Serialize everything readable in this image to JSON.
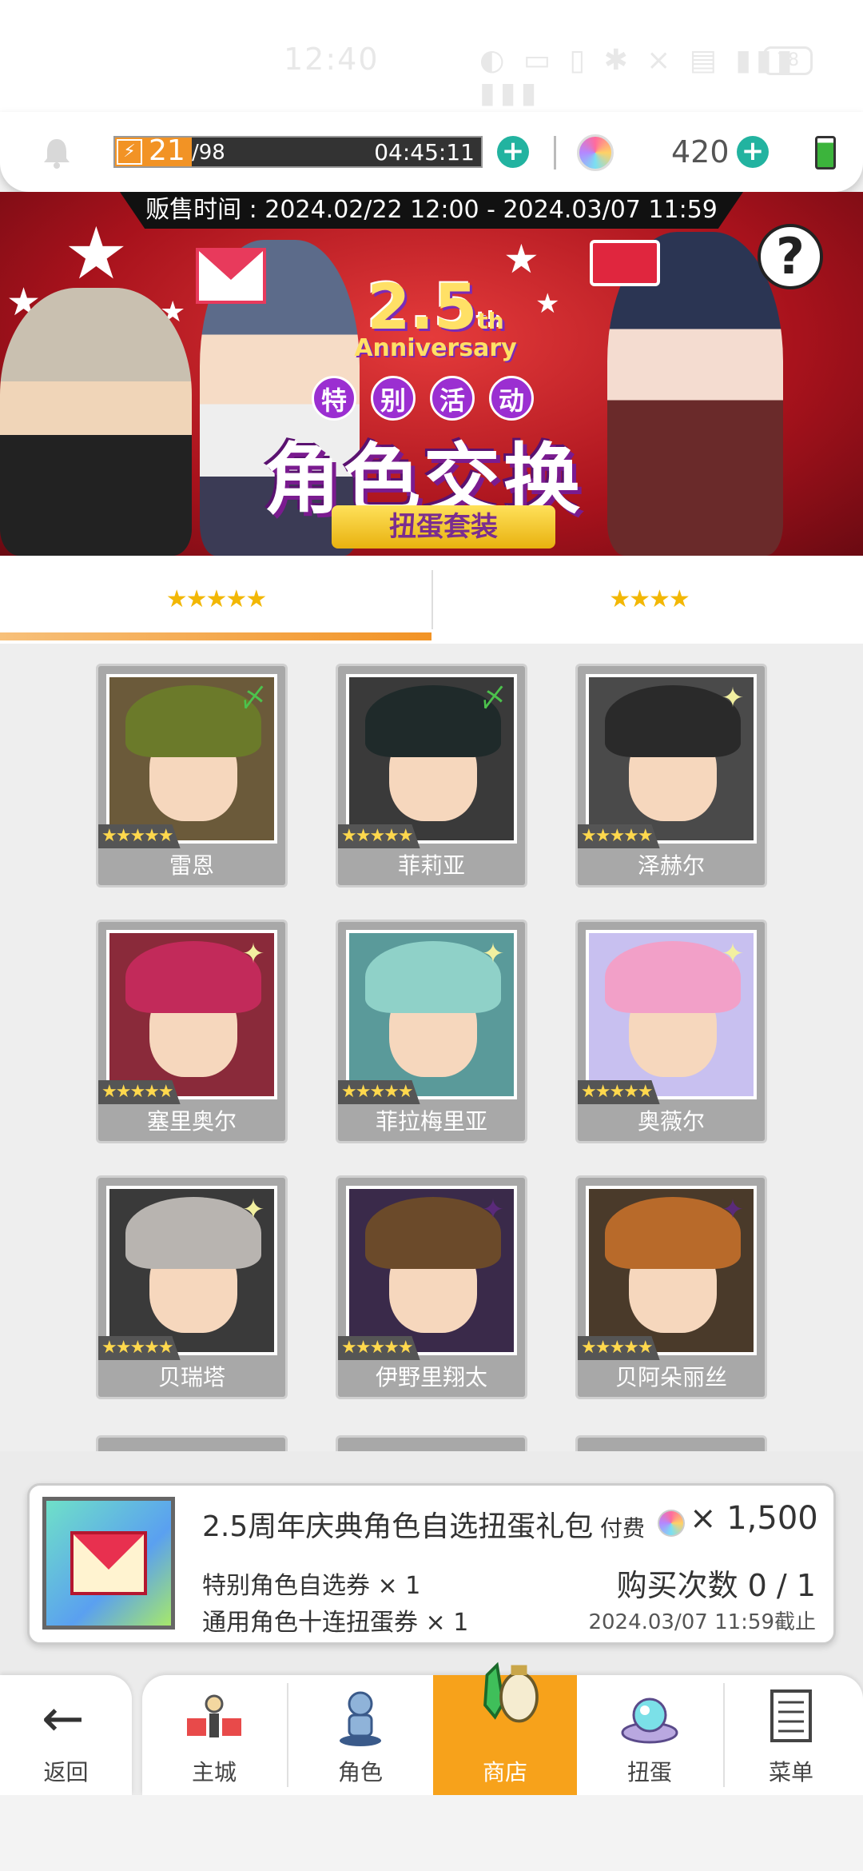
{
  "status_bar": {
    "time": "12:40",
    "icons": "◐ ▭   ▯ ✱ ⨯ ▤ ▮▮▮ ▮▮▮",
    "battery": "78"
  },
  "resources": {
    "stamina_current": "21",
    "stamina_max": "/98",
    "stamina_fraction": 0.21,
    "timer": "04:45:11",
    "gems": "420",
    "accent_color": "#22b3a0"
  },
  "banner": {
    "sale_time": "贩售时间 : 2024.02/22 12:00 - 2024.03/07 11:59",
    "anniversary_number": "2.5",
    "anniversary_suffix": "th",
    "anniversary_word": "Anniversary",
    "special_chars": [
      "特",
      "别",
      "活",
      "动"
    ],
    "title": "角色交换",
    "ribbon": "扭蛋套装",
    "help": "?"
  },
  "tabs": [
    {
      "label": "★★★★★"
    },
    {
      "label": "★★★★"
    }
  ],
  "characters": [
    {
      "name": "雷恩",
      "stars": "★★★★★",
      "element": "wind-icon",
      "element_glyph": "〆",
      "element_color": "#4cc24c",
      "hair": "#6b7a2a",
      "bg": "#6b5a3a"
    },
    {
      "name": "菲莉亚",
      "stars": "★★★★★",
      "element": "wind-icon",
      "element_glyph": "〆",
      "element_color": "#4cc24c",
      "hair": "#1f2a2a",
      "bg": "#3a3a3a"
    },
    {
      "name": "泽赫尔",
      "stars": "★★★★★",
      "element": "light-icon",
      "element_glyph": "✦",
      "element_color": "#f2f0a0",
      "hair": "#2a2a2a",
      "bg": "#4a4a4a"
    },
    {
      "name": "塞里奥尔",
      "stars": "★★★★★",
      "element": "light-icon",
      "element_glyph": "✦",
      "element_color": "#f2f0a0",
      "hair": "#c22a5a",
      "bg": "#8a2a3a"
    },
    {
      "name": "菲拉梅里亚",
      "stars": "★★★★★",
      "element": "light-icon",
      "element_glyph": "✦",
      "element_color": "#f2f0a0",
      "hair": "#8fd1c8",
      "bg": "#5a9a9a"
    },
    {
      "name": "奥薇尔",
      "stars": "★★★★★",
      "element": "light-icon",
      "element_glyph": "✦",
      "element_color": "#f2f0a0",
      "hair": "#f2a0c8",
      "bg": "#c8c0f0"
    },
    {
      "name": "贝瑞塔",
      "stars": "★★★★★",
      "element": "light-icon",
      "element_glyph": "✦",
      "element_color": "#f2f0a0",
      "hair": "#b8b4b0",
      "bg": "#3a3a3a"
    },
    {
      "name": "伊野里翔太",
      "stars": "★★★★★",
      "element": "shadow-icon",
      "element_glyph": "✦",
      "element_color": "#5a2a7a",
      "hair": "#6b4a2a",
      "bg": "#3a2a4a"
    },
    {
      "name": "贝阿朵丽丝",
      "stars": "★★★★★",
      "element": "shadow-icon",
      "element_glyph": "✦",
      "element_color": "#5a2a7a",
      "hair": "#b86a2a",
      "bg": "#4a3a2a"
    }
  ],
  "product": {
    "title": "2.5周年庆典角色自选扭蛋礼包",
    "pay_label": "付费",
    "price": "× 1,500",
    "item1": "特别角色自选券 × 1",
    "item2": "通用角色十连扭蛋券 × 1",
    "buy_count": "购买次数 0 / 1",
    "deadline": "2024.03/07 11:59截止"
  },
  "nav": {
    "back": "返回",
    "items": [
      {
        "label": "主城",
        "icon": "town-icon"
      },
      {
        "label": "角色",
        "icon": "character-icon"
      },
      {
        "label": "商店",
        "icon": "shop-icon",
        "active": true
      },
      {
        "label": "扭蛋",
        "icon": "gacha-icon"
      },
      {
        "label": "菜单",
        "icon": "menu-icon"
      }
    ],
    "active_color": "#f7a21b"
  }
}
